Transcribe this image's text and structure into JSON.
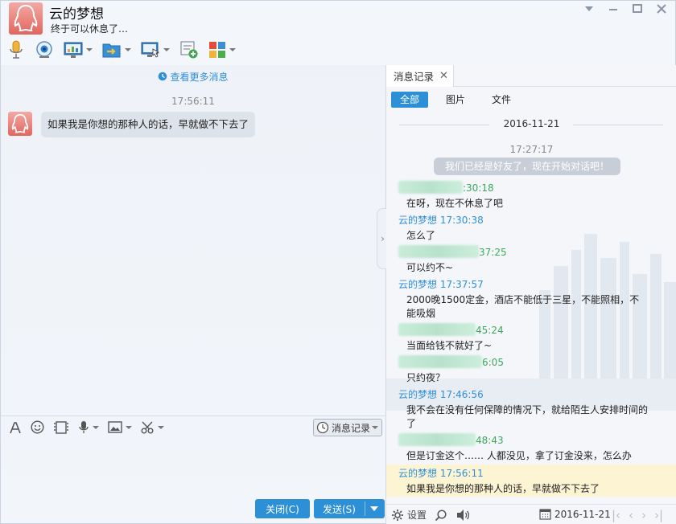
{
  "header": {
    "name": "云的梦想",
    "status": "终于可以休息了…"
  },
  "chat": {
    "more_messages": "查看更多消息",
    "timestamp": "17:56:11",
    "message": "如果我是你想的那种人的话，早就做不下去了"
  },
  "input_toolbar": {
    "history_label": "消息记录"
  },
  "buttons": {
    "close": "关闭(C)",
    "send": "发送(S)"
  },
  "history": {
    "tab_label": "消息记录",
    "filters": [
      "全部",
      "图片",
      "文件"
    ],
    "date": "2016-11-21",
    "first_time": "17:27:17",
    "system_message": "我们已经是好友了，现在开始对话吧！",
    "messages": [
      {
        "sender": "",
        "time": ":30:18",
        "text": "在呀，现在不休息了吧",
        "own": false
      },
      {
        "sender": "云的梦想",
        "time": "17:30:38",
        "text": "怎么了",
        "own": true
      },
      {
        "sender": "",
        "time": "37:25",
        "text": "可以约不~",
        "own": false
      },
      {
        "sender": "云的梦想",
        "time": "17:37:57",
        "text": "2000晚1500定金，酒店不能低于三星，不能照相，不能吸烟",
        "own": true
      },
      {
        "sender": "",
        "time": "45:24",
        "text": "当面给钱不就好了~",
        "own": false
      },
      {
        "sender": "",
        "time": "6:05",
        "text": "只约夜？",
        "own": false
      },
      {
        "sender": "云的梦想",
        "time": "17:46:56",
        "text": "我不会在没有任何保障的情况下，就给陌生人安排时间的了",
        "own": true
      },
      {
        "sender": "",
        "time": "48:43",
        "text": "但是订金这个…… 人都没见，拿了订金没来，怎么办",
        "own": false
      },
      {
        "sender": "云的梦想",
        "time": "17:56:11",
        "text": "如果我是你想的那种人的话，早就做不下去了",
        "own": true
      }
    ],
    "bottom": {
      "settings": "设置",
      "date": "2016-11-21"
    }
  },
  "colors": {
    "accent": "#2d90d6",
    "sender_blue": "#2f8fd8",
    "sender_green": "#3aaa5a",
    "highlight": "#fdf4d4"
  }
}
